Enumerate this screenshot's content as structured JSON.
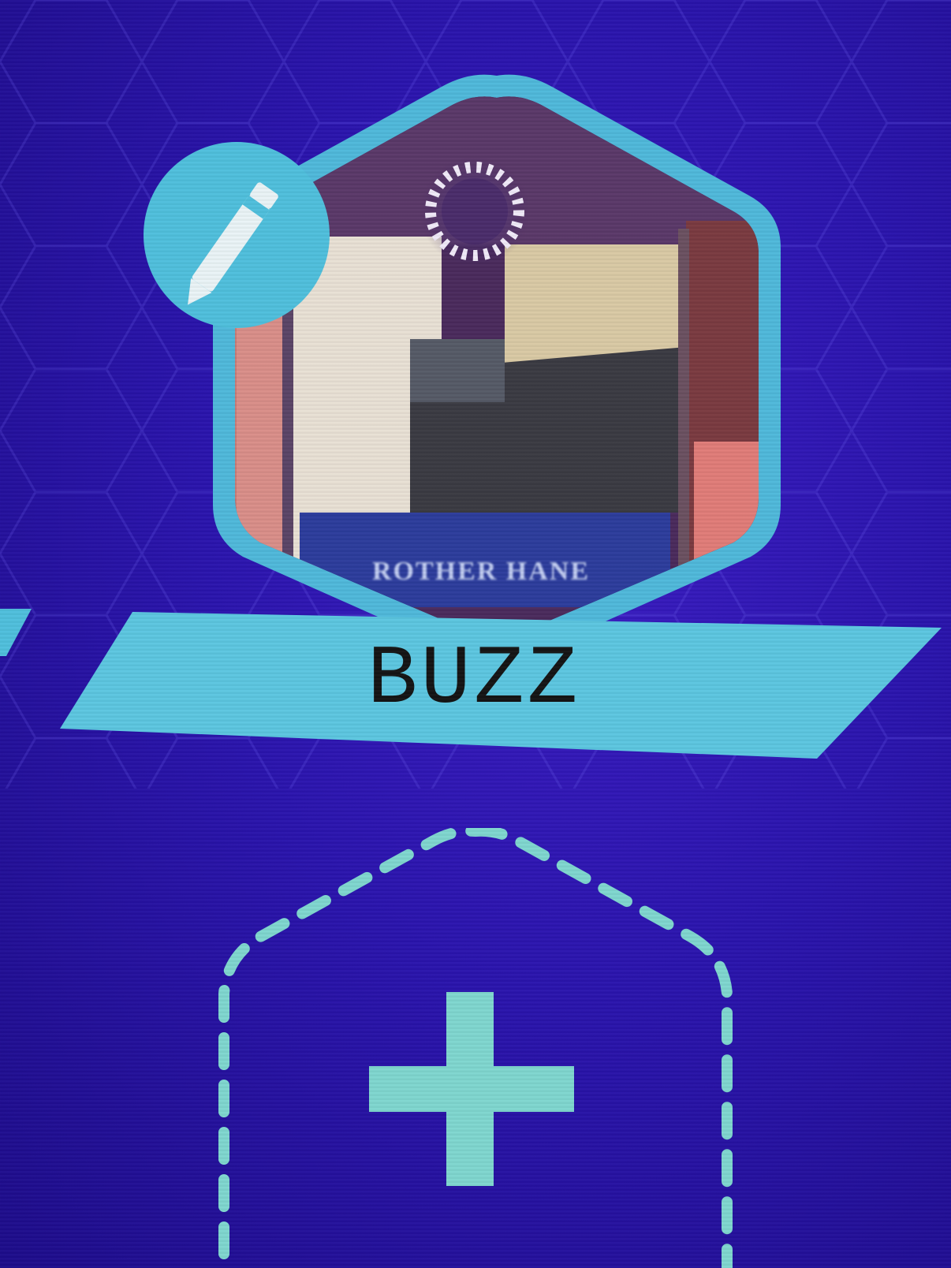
{
  "profile": {
    "name": "BUZZ",
    "card_caption": "ROTHER HANE"
  },
  "icons": {
    "edit": "pencil-icon",
    "add": "plus-icon"
  },
  "colors": {
    "background": "#2a14ad",
    "accent": "#4fbfdc",
    "add_slot": "#7fd6cf",
    "banner_text": "#141414"
  }
}
